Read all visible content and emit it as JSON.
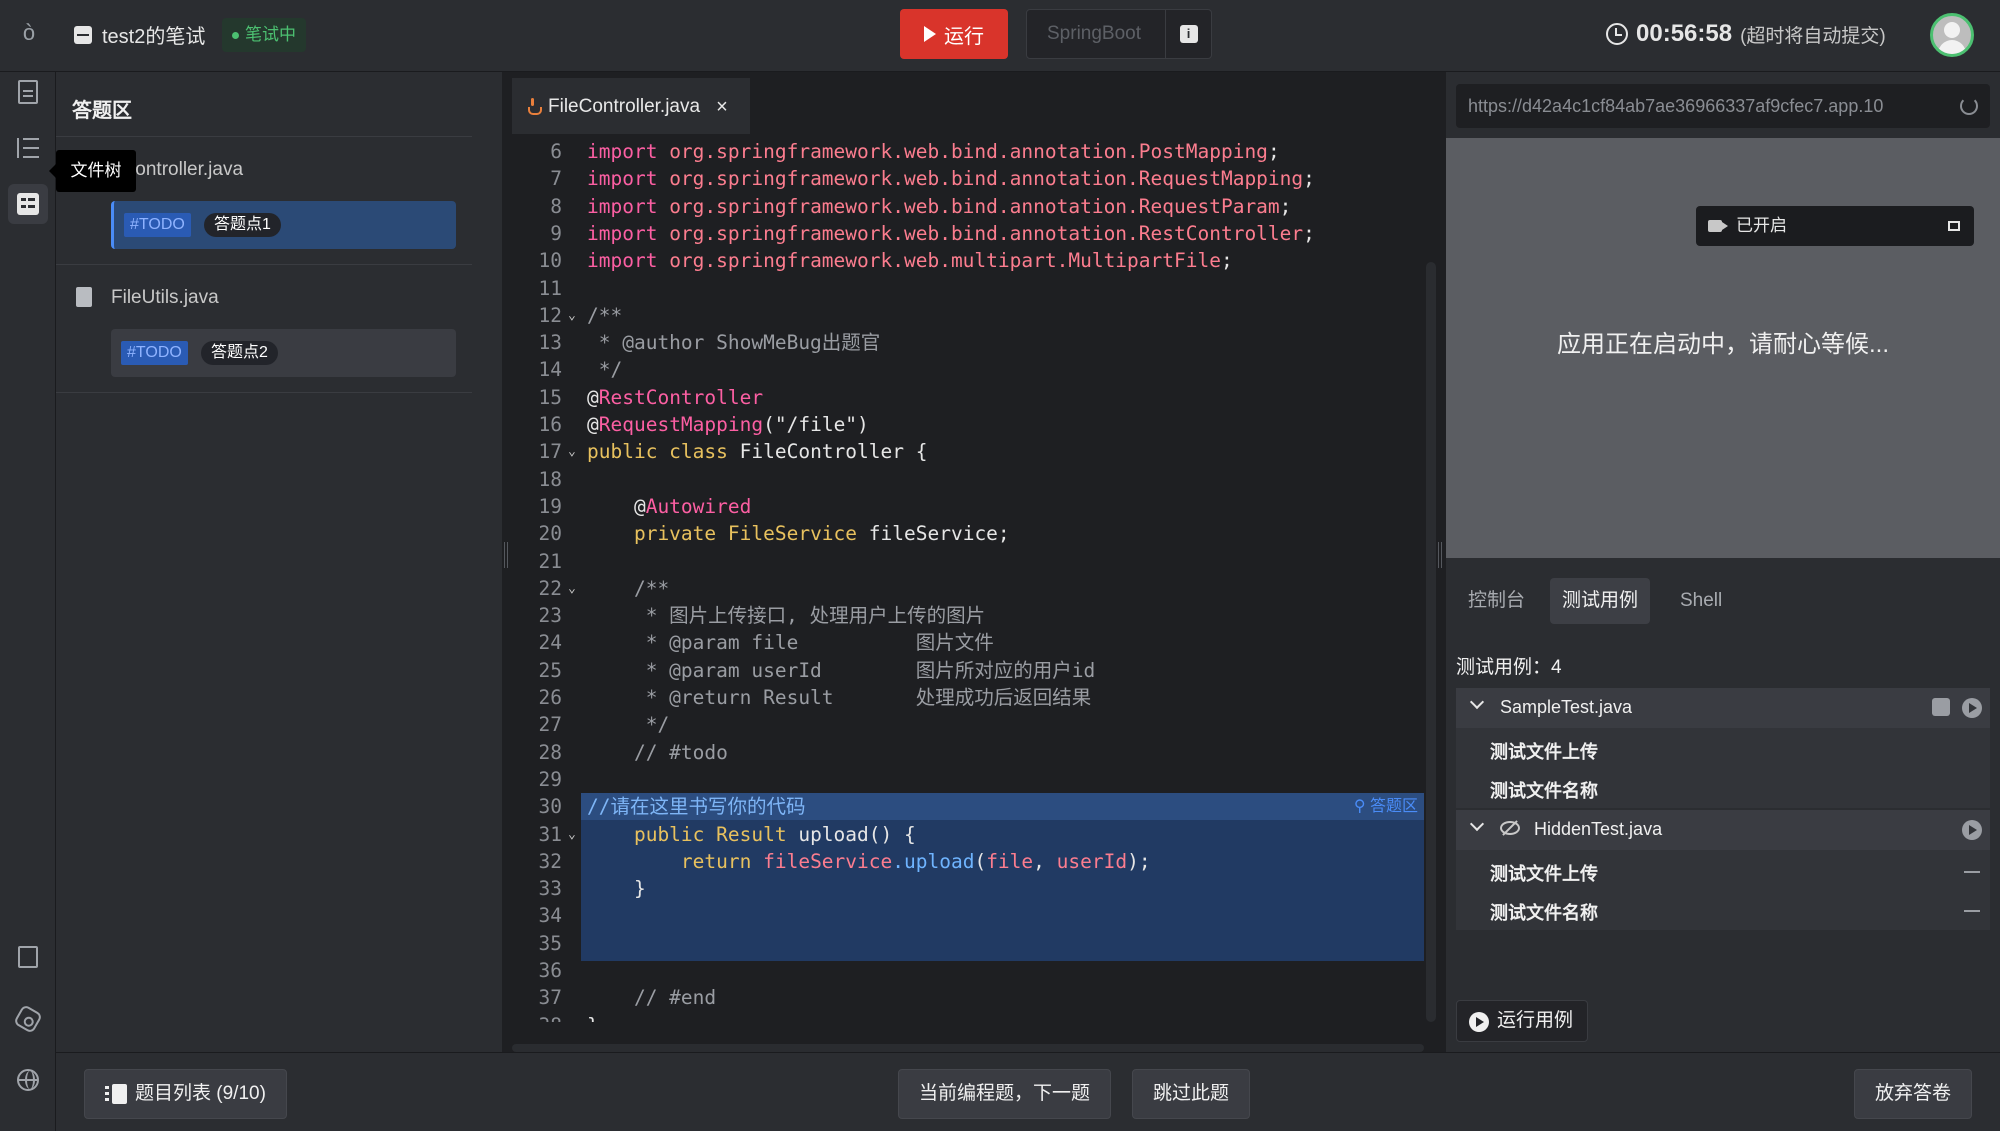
{
  "header": {
    "exam_title": "test2的笔试",
    "status": "笔试中",
    "run_label": "运行",
    "env_label": "SpringBoot",
    "info_icon": "info-icon",
    "time": "00:56:58",
    "time_note": "(超时将自动提交)",
    "colors": {
      "run": "#d9342b",
      "status": "#4cc071",
      "accent": "#4a8cf7"
    }
  },
  "rail": {
    "tooltip": "文件树",
    "icons": [
      "logo-icon",
      "document-icon",
      "file-tree-icon",
      "task-list-icon",
      "edit-notes-icon",
      "settings-hex-icon",
      "globe-icon"
    ]
  },
  "answer_panel": {
    "title": "答题区",
    "files": [
      {
        "name": "FileController.java",
        "visible_name": "eController.java",
        "todo_tag": "#TODO",
        "todo_label": "答题点1",
        "selected": true
      },
      {
        "name": "FileUtils.java",
        "visible_name": "FileUtils.java",
        "todo_tag": "#TODO",
        "todo_label": "答题点2",
        "selected": false
      }
    ]
  },
  "editor": {
    "tab_label": "FileController.java",
    "answer_area_label": "答题区",
    "lines": [
      {
        "n": "6",
        "fold": "",
        "parts": [
          [
            "pk",
            "import "
          ],
          [
            "var",
            "org.springframework.web.bind.annotation.PostMapping"
          ],
          [
            "str",
            ";"
          ]
        ]
      },
      {
        "n": "7",
        "fold": "",
        "parts": [
          [
            "pk",
            "import "
          ],
          [
            "var",
            "org.springframework.web.bind.annotation.RequestMapping"
          ],
          [
            "str",
            ";"
          ]
        ]
      },
      {
        "n": "8",
        "fold": "",
        "parts": [
          [
            "pk",
            "import "
          ],
          [
            "var",
            "org.springframework.web.bind.annotation.RequestParam"
          ],
          [
            "str",
            ";"
          ]
        ]
      },
      {
        "n": "9",
        "fold": "",
        "parts": [
          [
            "pk",
            "import "
          ],
          [
            "var",
            "org.springframework.web.bind.annotation.RestController"
          ],
          [
            "str",
            ";"
          ]
        ]
      },
      {
        "n": "10",
        "fold": "",
        "parts": [
          [
            "pk",
            "import "
          ],
          [
            "var",
            "org.springframework.web.multipart.MultipartFile"
          ],
          [
            "str",
            ";"
          ]
        ]
      },
      {
        "n": "11",
        "fold": "",
        "parts": []
      },
      {
        "n": "12",
        "fold": "v",
        "parts": [
          [
            "cmt",
            "/**"
          ]
        ]
      },
      {
        "n": "13",
        "fold": "",
        "parts": [
          [
            "cmt",
            " * @author ShowMeBug出题官"
          ]
        ]
      },
      {
        "n": "14",
        "fold": "",
        "parts": [
          [
            "cmt",
            " */"
          ]
        ]
      },
      {
        "n": "15",
        "fold": "",
        "parts": [
          [
            "str",
            "@"
          ],
          [
            "ann",
            "RestController"
          ]
        ]
      },
      {
        "n": "16",
        "fold": "",
        "parts": [
          [
            "str",
            "@"
          ],
          [
            "ann",
            "RequestMapping"
          ],
          [
            "str",
            "(\"/file\")"
          ]
        ]
      },
      {
        "n": "17",
        "fold": "v",
        "parts": [
          [
            "kw",
            "public class "
          ],
          [
            "str",
            "FileController {"
          ]
        ]
      },
      {
        "n": "18",
        "fold": "",
        "parts": []
      },
      {
        "n": "19",
        "fold": "",
        "parts": [
          [
            "str",
            "    @"
          ],
          [
            "ann",
            "Autowired"
          ]
        ]
      },
      {
        "n": "20",
        "fold": "",
        "parts": [
          [
            "kw",
            "    private "
          ],
          [
            "cls",
            "FileService "
          ],
          [
            "str",
            "fileService;"
          ]
        ]
      },
      {
        "n": "21",
        "fold": "",
        "parts": []
      },
      {
        "n": "22",
        "fold": "v",
        "parts": [
          [
            "cmt",
            "    /**"
          ]
        ]
      },
      {
        "n": "23",
        "fold": "",
        "parts": [
          [
            "cmt",
            "     * 图片上传接口, 处理用户上传的图片"
          ]
        ]
      },
      {
        "n": "24",
        "fold": "",
        "parts": [
          [
            "cmt",
            "     * @param file          图片文件"
          ]
        ]
      },
      {
        "n": "25",
        "fold": "",
        "parts": [
          [
            "cmt",
            "     * @param userId        图片所对应的用户id"
          ]
        ]
      },
      {
        "n": "26",
        "fold": "",
        "parts": [
          [
            "cmt",
            "     * @return Result       处理成功后返回结果"
          ]
        ]
      },
      {
        "n": "27",
        "fold": "",
        "parts": [
          [
            "cmt",
            "     */"
          ]
        ]
      },
      {
        "n": "28",
        "fold": "",
        "parts": [
          [
            "cmt",
            "    // #todo"
          ]
        ]
      },
      {
        "n": "29",
        "fold": "",
        "parts": []
      },
      {
        "n": "30",
        "fold": "",
        "parts": [
          [
            "cmt-cn",
            "//请在这里书写你的代码"
          ]
        ]
      },
      {
        "n": "31",
        "fold": "v",
        "parts": [
          [
            "kw",
            "    public "
          ],
          [
            "cls",
            "Result "
          ],
          [
            "str",
            "upload() {"
          ]
        ]
      },
      {
        "n": "32",
        "fold": "",
        "parts": [
          [
            "kw",
            "        return "
          ],
          [
            "var",
            "fileService"
          ],
          [
            "blue",
            ".upload"
          ],
          [
            "str",
            "("
          ],
          [
            "var",
            "file"
          ],
          [
            "str",
            ", "
          ],
          [
            "var",
            "userId"
          ],
          [
            "str",
            ");"
          ]
        ]
      },
      {
        "n": "33",
        "fold": "",
        "parts": [
          [
            "str",
            "    }"
          ]
        ]
      },
      {
        "n": "34",
        "fold": "",
        "parts": []
      },
      {
        "n": "35",
        "fold": "",
        "parts": []
      },
      {
        "n": "36",
        "fold": "",
        "parts": []
      },
      {
        "n": "37",
        "fold": "",
        "parts": [
          [
            "cmt",
            "    // #end"
          ]
        ]
      },
      {
        "n": "38",
        "fold": "",
        "parts": [
          [
            "str",
            "}"
          ]
        ]
      }
    ]
  },
  "right_panel": {
    "url": "https://d42a4c1cf84ab7ae36966337af9cfec7.app.10",
    "camera_label": "已开启",
    "preview_message": "应用正在启动中，请耐心等候...",
    "tabs": [
      "控制台",
      "测试用例",
      "Shell"
    ],
    "active_tab": "测试用例",
    "case_count_label": "测试用例：4",
    "suites": [
      {
        "name": "SampleTest.java",
        "hidden": false,
        "cases": [
          "测试文件上传",
          "测试文件名称"
        ]
      },
      {
        "name": "HiddenTest.java",
        "hidden": true,
        "cases": [
          "测试文件上传",
          "测试文件名称"
        ]
      }
    ],
    "run_cases_label": "运行用例"
  },
  "footer": {
    "question_list": "题目列表 (9/10)",
    "next_label": "当前编程题，下一题",
    "skip_label": "跳过此题",
    "abandon_label": "放弃答卷"
  }
}
